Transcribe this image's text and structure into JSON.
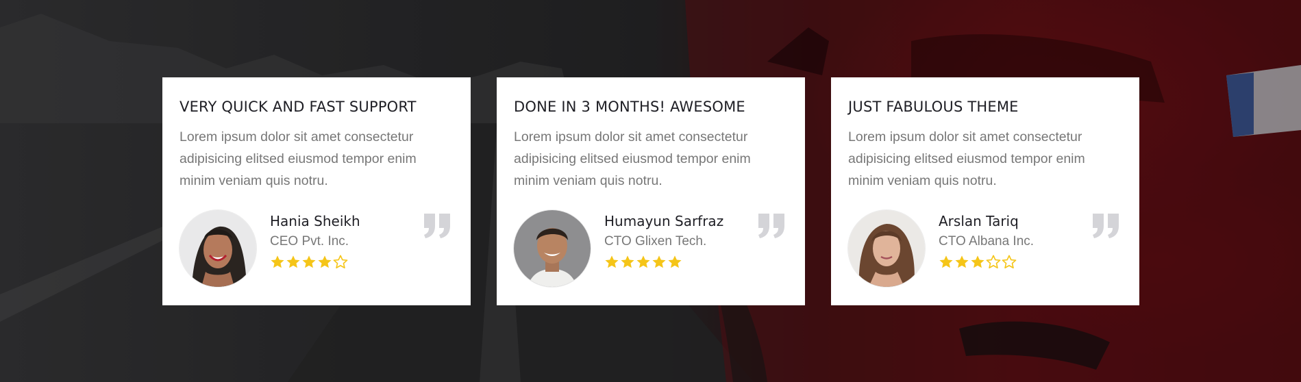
{
  "testimonials": [
    {
      "title": "VERY QUICK AND FAST SUPPORT",
      "text": "Lorem ipsum dolor sit amet consectetur adipisicing elitsed eiusmod tempor enim minim veniam quis notru.",
      "name": "Hania Sheikh",
      "role": "CEO Pvt. Inc.",
      "rating": 4,
      "rating_max": 5
    },
    {
      "title": "DONE IN 3 MONTHS! AWESOME",
      "text": "Lorem ipsum dolor sit amet consectetur adipisicing elitsed eiusmod tempor enim minim veniam quis notru.",
      "name": "Humayun Sarfraz",
      "role": "CTO Glixen Tech.",
      "rating": 5,
      "rating_max": 5
    },
    {
      "title": "JUST FABULOUS THEME",
      "text": "Lorem ipsum dolor sit amet consectetur adipisicing elitsed eiusmod tempor enim minim veniam quis notru.",
      "name": "Arslan Tariq",
      "role": "CTO Albana Inc.",
      "rating": 3,
      "rating_max": 5
    }
  ],
  "colors": {
    "star": "#f5c518",
    "quote_icon": "#d4d4d8",
    "title": "#1e1e24",
    "body_text": "#777777"
  },
  "icons": {
    "rating": "star-icon",
    "quote": "quote-icon"
  }
}
